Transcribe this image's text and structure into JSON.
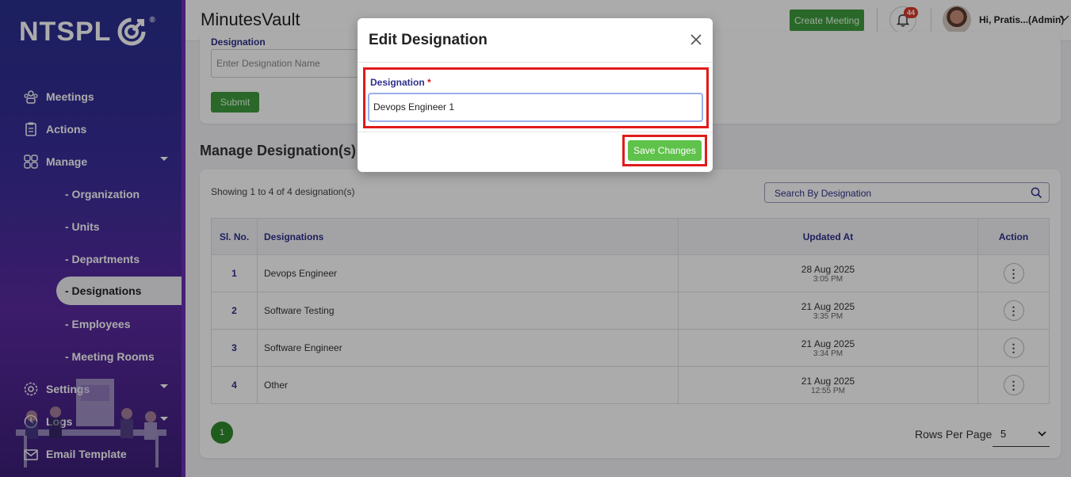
{
  "brand": {
    "logo_text": "NTSPL",
    "registered": "®"
  },
  "sidebar": {
    "items": [
      {
        "label": "Meetings",
        "icon": "meetings-icon"
      },
      {
        "label": "Actions",
        "icon": "clipboard-icon"
      },
      {
        "label": "Manage",
        "icon": "grid-icon"
      }
    ],
    "sub_items": [
      {
        "label": "- Organization"
      },
      {
        "label": "- Units"
      },
      {
        "label": "- Departments"
      },
      {
        "label": "- Designations"
      },
      {
        "label": "- Employees"
      },
      {
        "label": "- Meeting Rooms"
      }
    ],
    "bottom_items": [
      {
        "label": "Settings"
      },
      {
        "label": "Logs"
      },
      {
        "label": "Email Template"
      }
    ]
  },
  "header": {
    "app_title": "MinutesVault",
    "create_meeting": "Create Meeting",
    "notification_count": "44",
    "user_greeting": "Hi, Pratis...(Admin)"
  },
  "form": {
    "label": "Designation",
    "placeholder": "Enter Designation Name",
    "submit": "Submit"
  },
  "list": {
    "section_title": "Manage Designation(s)",
    "showing": "Showing 1 to 4 of 4 designation(s)",
    "search_placeholder": "Search By Designation",
    "columns": [
      "Sl. No.",
      "Designations",
      "Updated At",
      "Action"
    ],
    "rows": [
      {
        "no": "1",
        "name": "Devops Engineer",
        "date": "28 Aug 2025",
        "time": "3:05 PM"
      },
      {
        "no": "2",
        "name": "Software Testing",
        "date": "21 Aug 2025",
        "time": "3:35 PM"
      },
      {
        "no": "3",
        "name": "Software Engineer",
        "date": "21 Aug 2025",
        "time": "3:34 PM"
      },
      {
        "no": "4",
        "name": "Other",
        "date": "21 Aug 2025",
        "time": "12:55 PM"
      }
    ],
    "current_page": "1",
    "rows_per_page_label": "Rows Per Page",
    "rows_per_page_value": "5"
  },
  "modal": {
    "title": "Edit Designation",
    "field_label": "Designation",
    "required_mark": "*",
    "field_value": "Devops Engineer 1",
    "save_label": "Save Changes"
  },
  "colors": {
    "accent_green": "#3e9b3e",
    "save_green": "#5fc24a",
    "highlight_red": "#e11b1b",
    "label_navy": "#2f2f8a"
  }
}
